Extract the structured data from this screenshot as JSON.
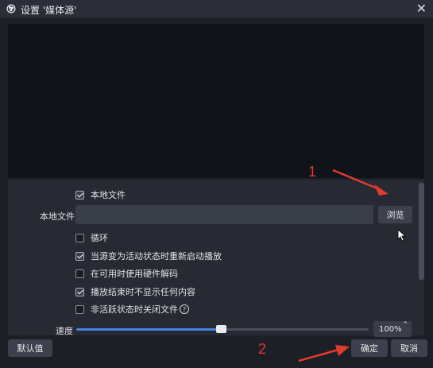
{
  "window": {
    "title": "设置 '媒体源'",
    "close_label": "✕"
  },
  "props": {
    "local_file_check": {
      "label": "本地文件",
      "checked": true
    },
    "local_file_field": {
      "label": "本地文件",
      "value": ""
    },
    "browse_label": "浏览",
    "loop": {
      "label": "循环",
      "checked": false
    },
    "restart_on_active": {
      "label": "当源变为活动状态时重新启动播放",
      "checked": true
    },
    "hw_decode": {
      "label": "在可用时使用硬件解码",
      "checked": false
    },
    "hide_on_end": {
      "label": "播放结束时不显示任何内容",
      "checked": true
    },
    "close_when_inactive": {
      "label": "非活跃状态时关闭文件",
      "checked": false
    },
    "help_glyph": "?"
  },
  "speed": {
    "label": "速度",
    "value": "100%",
    "slider_fraction": 0.5
  },
  "buttons": {
    "defaults": "默认值",
    "ok": "确定",
    "cancel": "取消"
  },
  "annotations": {
    "one": "1",
    "two": "2"
  },
  "colors": {
    "accent": "#3f86e0",
    "annotation": "#e33a2f"
  }
}
